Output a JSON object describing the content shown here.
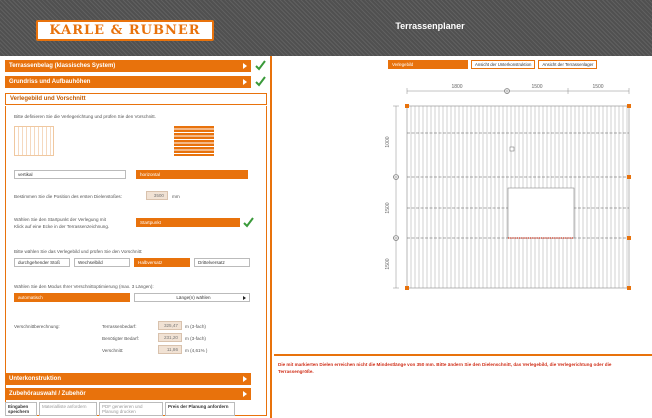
{
  "header": {
    "logo": "KARLE & RUBNER",
    "title": "Terrassenplaner"
  },
  "sidebar": {
    "sections_done": [
      {
        "label": "Terrassenbelag (klassisches System)",
        "done": true
      },
      {
        "label": "Grundriss und Aufbauhöhen",
        "done": true
      }
    ],
    "open_section": "Verlegebild und Vorschnitt",
    "intro": "Bitte definieren Sie die Verlegerichtung und prüfen Sie den Vorschnitt.",
    "direction_options": [
      {
        "label": "vertikal",
        "selected": false
      },
      {
        "label": "horizontal",
        "selected": true
      }
    ],
    "position_text": "Bestimmen Sie die Position des ersten Dielenstoßes:",
    "position_value": "3500",
    "position_unit": "mm",
    "start_text_1": "Wählen Sie den Startpunkt der Verlegung mit",
    "start_text_2": "Klick auf eine Ecke in der Terrassenzeichnung.",
    "start_button": "Startpunkt",
    "pattern_text": "Bitte wählen Sie das Verlegebild und prüfen Sie den Vorschnitt:",
    "pattern_options": [
      {
        "label": "durchgehender Stoß",
        "selected": false
      },
      {
        "label": "Wechselbild",
        "selected": false
      },
      {
        "label": "Halbversatz",
        "selected": true
      },
      {
        "label": "Drittelversatz",
        "selected": false
      }
    ],
    "mode_text": "Wählen Sie den Modus Ihrer Verschnittoptimierung (max. 3 Längen):",
    "mode_value": "automatisch",
    "mode_select": "Länge(n) wählen",
    "calc_label": "Verschnittberechnung:",
    "calc_rows": [
      {
        "label": "Terrassenbedarf:",
        "value": "325,47",
        "unit": "m (3-fach)"
      },
      {
        "label": "Benötigter Bedarf:",
        "value": "231,20",
        "unit": "m (3-fach)"
      },
      {
        "label": "Verschnitt:",
        "value": "11,86",
        "unit": "m (4,61% )"
      }
    ],
    "closed_sections": [
      "Unterkonstruktion",
      "Zubehörauswahl / Zubehör"
    ],
    "bottom_buttons": [
      "Eingaben speichern",
      "Materialliste anfordern",
      "PDF generieren und Planung drucken",
      "Preis der Planung anfordern"
    ]
  },
  "main": {
    "view_tabs": [
      {
        "label": "Verlegebild",
        "active": true
      },
      {
        "label": "Ansicht der Unterkonstruktion",
        "active": false
      },
      {
        "label": "Ansicht der Terrassenlager",
        "active": false
      }
    ],
    "dims_top": [
      "1800",
      "1500",
      "1500"
    ],
    "dims_left": [
      "1000",
      "1500",
      "1500"
    ],
    "warning": "Die mit markierten Dielen erreichen nicht die Mindestlänge von 350 mm. Bitte ändern Sie den Dielenschnitt, das Verlegebild, die Verlegerichtung oder die Terrassengröße."
  },
  "colors": {
    "accent": "#e8720c",
    "header_bg": "#585858",
    "check": "#3a9a3a",
    "warning": "#d0301a"
  }
}
